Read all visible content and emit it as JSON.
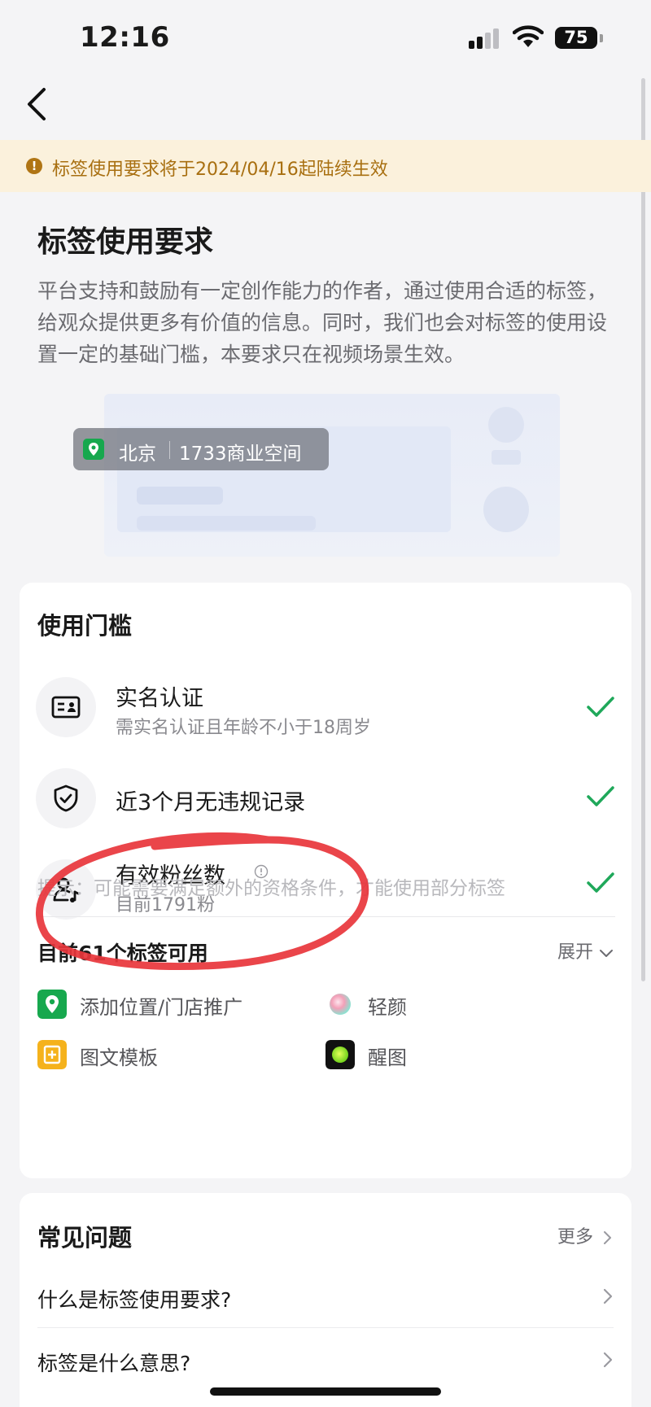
{
  "status_bar": {
    "time": "12:16",
    "battery": "75"
  },
  "notice": {
    "text": "标签使用要求将于2024/04/16起陆续生效",
    "icon": "!"
  },
  "intro": {
    "title": "标签使用要求",
    "description": "平台支持和鼓励有一定创作能力的作者，通过使用合适的标签，给观众提供更多有价值的信息。同时，我们也会对标签的使用设置一定的基础门槛，本要求只在视频场景生效。"
  },
  "preview": {
    "city": "北京",
    "place": "1733商业空间"
  },
  "requirements": {
    "title": "使用门槛",
    "items": [
      {
        "title": "实名认证",
        "subtitle": "需实名认证且年龄不小于18周岁",
        "icon": "id-card-icon",
        "met": true
      },
      {
        "title": "近3个月无违规记录",
        "subtitle": "",
        "icon": "shield-check-icon",
        "met": true
      },
      {
        "title": "有效粉丝数",
        "subtitle": "目前1791粉",
        "icon": "user-music-icon",
        "met": true
      }
    ],
    "tip": "提示：可能需要满足额外的资格条件，才能使用部分标签"
  },
  "available_tags": {
    "title": "目前61个标签可用",
    "expand_label": "展开",
    "items": [
      {
        "label": "添加位置/门店推广",
        "icon": "location-pin-icon",
        "color": "#17a84e"
      },
      {
        "label": "轻颜",
        "icon": "qingyan-app-icon",
        "color": "#f3a0b8"
      },
      {
        "label": "图文模板",
        "icon": "template-icon",
        "color": "#f5b21c"
      },
      {
        "label": "醒图",
        "icon": "xingtu-app-icon",
        "color": "#9ef01a"
      }
    ]
  },
  "faq": {
    "title": "常见问题",
    "more_label": "更多",
    "items": [
      {
        "question": "什么是标签使用要求?"
      },
      {
        "question": "标签是什么意思?"
      }
    ]
  },
  "colors": {
    "check": "#1fa85a",
    "notice_text": "#a86f10",
    "annotation": "#e8353b"
  }
}
